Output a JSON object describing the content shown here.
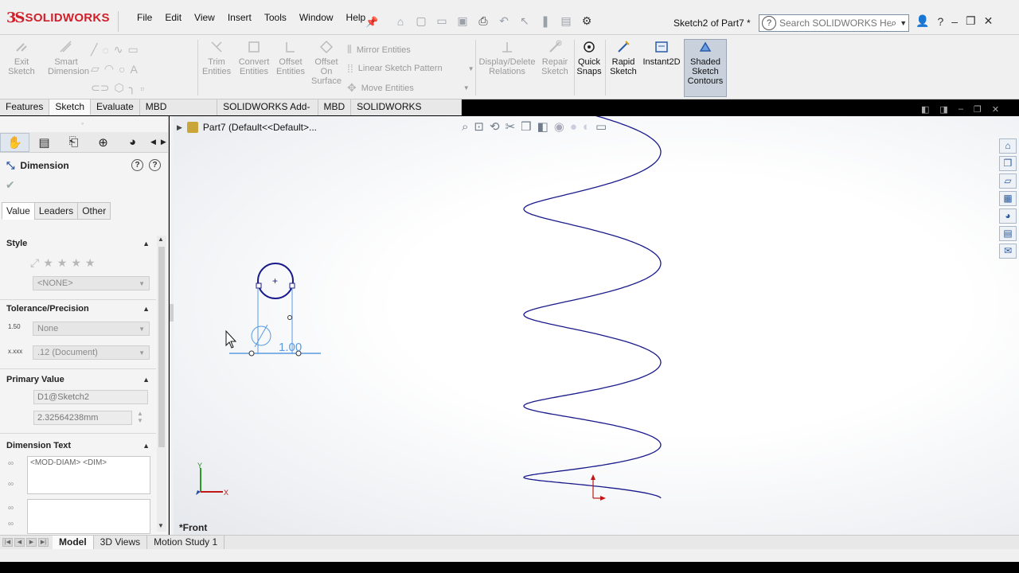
{
  "app": {
    "brand_prefix": "3S",
    "brand_name": "SOLIDWORKS",
    "doc_title": "Sketch2 of Part7 *"
  },
  "menu": [
    "File",
    "Edit",
    "View",
    "Insert",
    "Tools",
    "Window",
    "Help"
  ],
  "help_search": {
    "placeholder": "Search SOLIDWORKS Help"
  },
  "toolbar": {
    "exit_sketch": "Exit\nSketch",
    "smart_dimension": "Smart\nDimension",
    "trim_entities": "Trim\nEntities",
    "convert_entities": "Convert\nEntities",
    "offset_entities": "Offset\nEntities",
    "offset_on_surface": "Offset\nOn\nSurface",
    "mirror_entities": "Mirror Entities",
    "linear_sketch_pattern": "Linear Sketch Pattern",
    "move_entities": "Move Entities",
    "display_delete_relations": "Display/Delete\nRelations",
    "repair_sketch": "Repair\nSketch",
    "quick_snaps": "Quick\nSnaps",
    "rapid_sketch": "Rapid\nSketch",
    "instant2d": "Instant2D",
    "shaded_sketch_contours": "Shaded\nSketch\nContours"
  },
  "tabs": [
    {
      "label": "Features",
      "active": false
    },
    {
      "label": "Sketch",
      "active": true
    },
    {
      "label": "Evaluate",
      "active": false
    },
    {
      "label": "MBD Dimensions",
      "active": false
    },
    {
      "label": "SOLIDWORKS Add-Ins",
      "active": false
    },
    {
      "label": "MBD",
      "active": false
    },
    {
      "label": "SOLIDWORKS Inspection",
      "active": false
    }
  ],
  "property_manager": {
    "title": "Dimension",
    "subtabs": [
      {
        "label": "Value",
        "active": true
      },
      {
        "label": "Leaders",
        "active": false
      },
      {
        "label": "Other",
        "active": false
      }
    ],
    "style": {
      "header": "Style",
      "select": "<NONE>"
    },
    "tolerance": {
      "header": "Tolerance/Precision",
      "tolerance_type": "None",
      "precision": ".12 (Document)",
      "tol_icon_text": "1.50",
      "prec_icon_text": "x.xxx"
    },
    "primary_value": {
      "header": "Primary Value",
      "name": "D1@Sketch2",
      "value": "2.32564238mm"
    },
    "dimension_text": {
      "header": "Dimension Text",
      "text": "<MOD-DIAM> <DIM>"
    }
  },
  "feature_tree": {
    "part_label": "Part7  (Default<<Default>..."
  },
  "graphics": {
    "view_label": "*Front",
    "dimension_text": "1.00",
    "diameter_symbol": "Ø",
    "triad_y": "Y",
    "triad_x": "X",
    "sketch_color": "#1a1a8c",
    "dim_color": "#5a9be0"
  },
  "bottom_tabs": [
    {
      "label": "Model",
      "active": true
    },
    {
      "label": "3D Views",
      "active": false
    },
    {
      "label": "Motion Study 1",
      "active": false
    }
  ]
}
